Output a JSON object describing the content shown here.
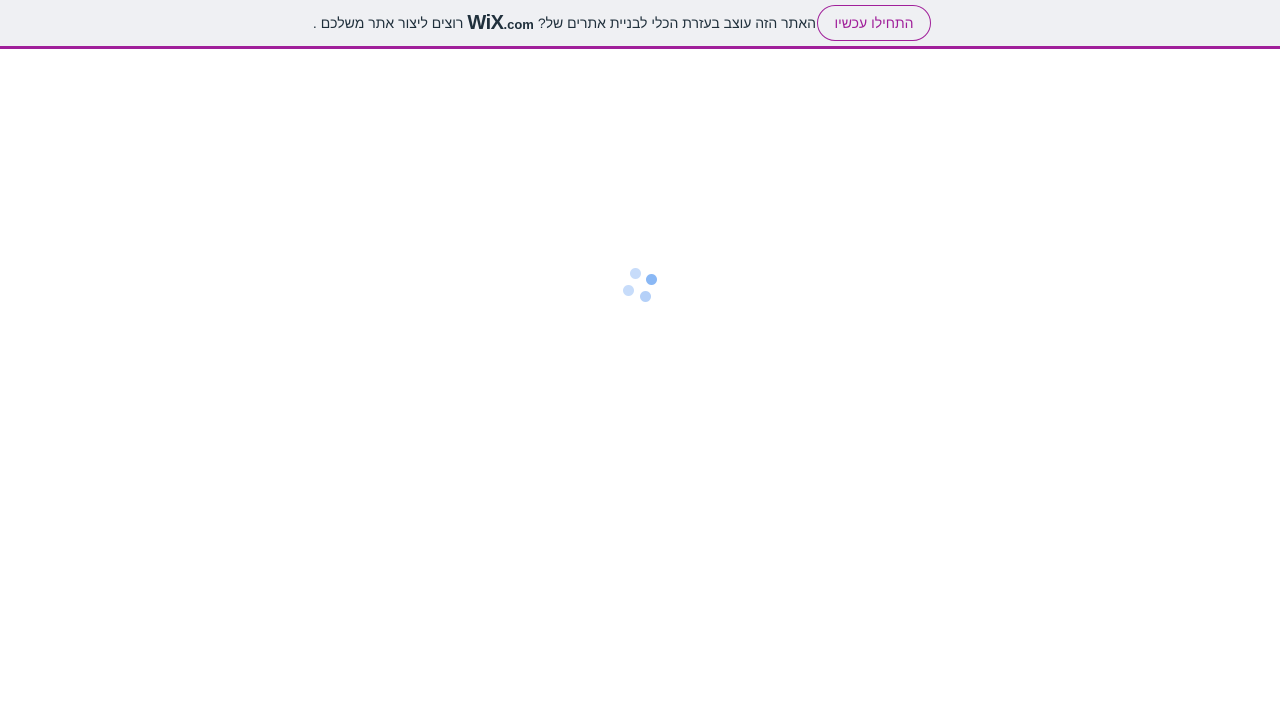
{
  "banner": {
    "message_end": "?האתר הזה עוצב בעזרת הכלי לבניית אתרים של",
    "logo_word": "WiX",
    "logo_tld": ".com",
    "message_start": ". רוצים ליצור אתר משלכם",
    "cta_label": "התחילו עכשיו",
    "accent_color": "#a01f9a",
    "background_color": "#eff0f3"
  },
  "loader": {
    "icon": "loading-spinner-icon",
    "color": "#8ab8f5"
  }
}
